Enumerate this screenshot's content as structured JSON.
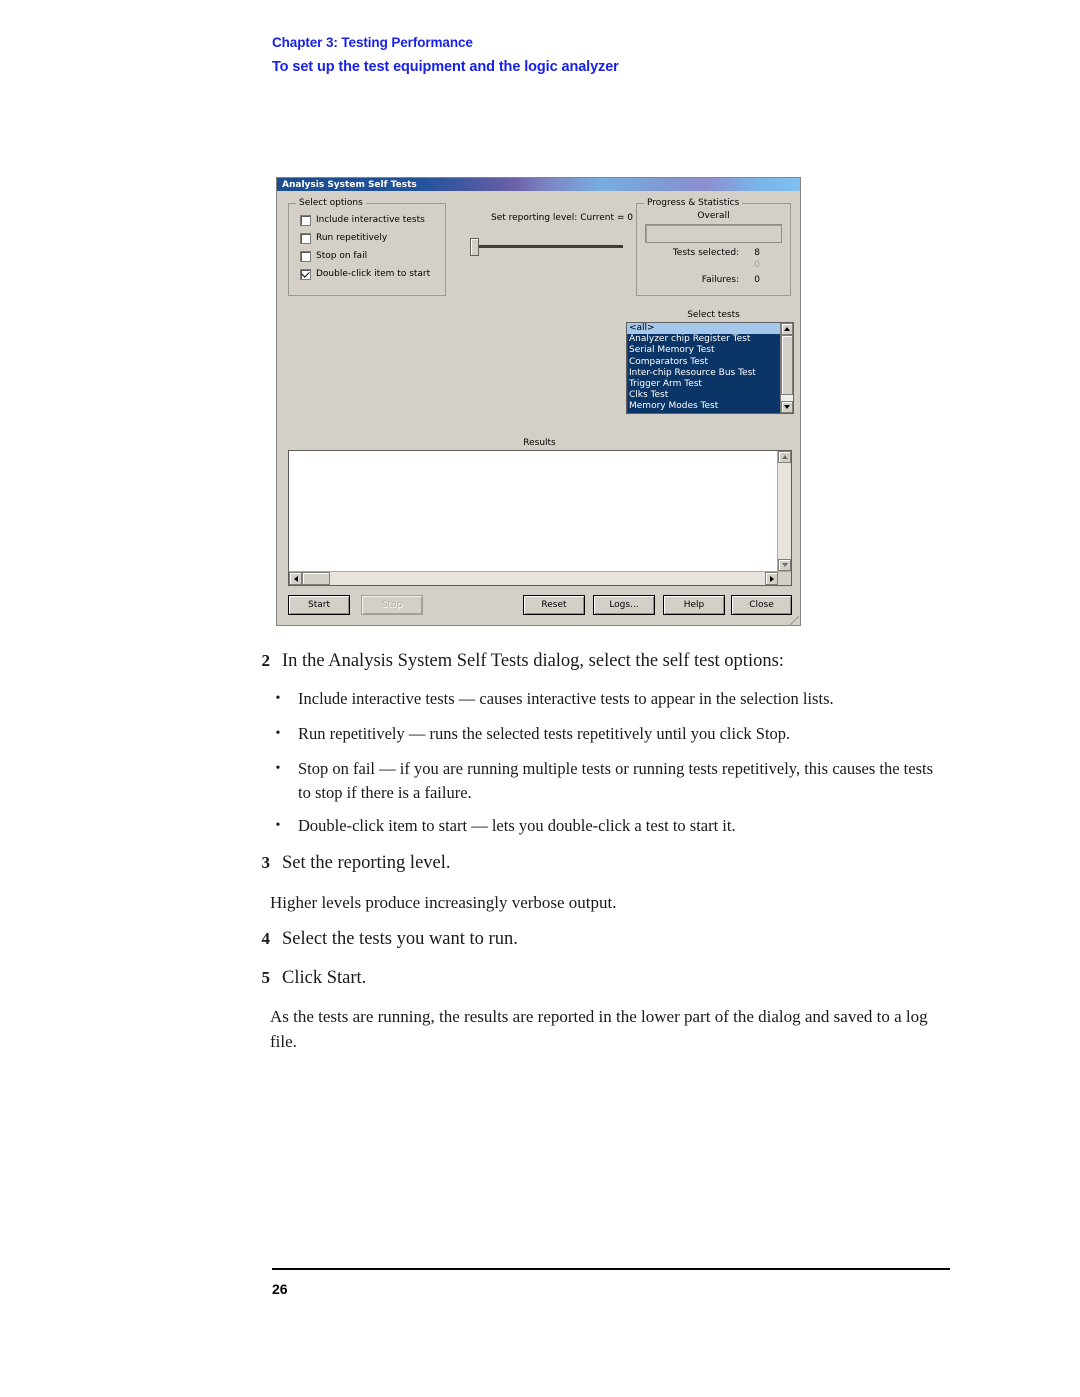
{
  "header": {
    "chapter": "Chapter 3: Testing Performance",
    "task": "To set up the test equipment and the logic analyzer",
    "accent_color": "#1822e6"
  },
  "dialog": {
    "title": "Analysis System Self Tests",
    "options_group": {
      "legend": "Select options",
      "items": [
        {
          "label": "Include interactive tests",
          "checked": false
        },
        {
          "label": "Run repetitively",
          "checked": false
        },
        {
          "label": "Stop on fail",
          "checked": false
        },
        {
          "label": "Double-click item to start",
          "checked": true
        }
      ]
    },
    "reporting": {
      "caption": "Set reporting level: Current =  0",
      "value": 0
    },
    "stats_group": {
      "legend": "Progress & Statistics",
      "overall_label": "Overall",
      "progress_percent": 0,
      "tests_selected_label": "Tests selected:",
      "tests_selected_value": "8",
      "middle_faint_value": "0",
      "failures_label": "Failures:",
      "failures_value": "0"
    },
    "select_tests": {
      "label": "Select tests",
      "items": [
        "<all>",
        "Analyzer chip Register Test",
        "Serial Memory Test",
        "Comparators Test",
        "Inter-chip Resource Bus Test",
        "Trigger Arm Test",
        "Clks Test",
        "Memory Modes Test"
      ],
      "current_index": 0,
      "selection_bg": "#0b3566",
      "current_bg": "#a4c8ec"
    },
    "results": {
      "label": "Results",
      "content": ""
    },
    "buttons": [
      {
        "id": "start",
        "label": "Start",
        "disabled": false
      },
      {
        "id": "stop",
        "label": "Stop",
        "disabled": true
      },
      {
        "id": "reset",
        "label": "Reset",
        "disabled": false
      },
      {
        "id": "logs",
        "label": "Logs...",
        "disabled": false
      },
      {
        "id": "help",
        "label": "Help",
        "disabled": false
      },
      {
        "id": "close",
        "label": "Close",
        "disabled": false
      }
    ]
  },
  "content": {
    "step2_num": "2",
    "step2_text": "In the Analysis System Self Tests dialog, select the self test options:",
    "bullets": [
      "Include interactive tests — causes interactive tests to appear in the selection lists.",
      "Run repetitively — runs the selected tests repetitively until you click Stop.",
      "Stop on fail — if you are running multiple tests or running tests repetitively, this causes the tests to stop if there is a failure.",
      "Double-click item to start — lets you double-click a test to start it."
    ],
    "bullet_marker": "•",
    "step3_num": "3",
    "step3_text": "Set the reporting level.",
    "step3_para": "Higher levels produce increasingly verbose output.",
    "step4_num": "4",
    "step4_text": "Select the tests you want to run.",
    "step5_num": "5",
    "step5_text": "Click Start.",
    "step5_para": "As the tests are running, the results are reported in the lower part of the dialog and saved to a log file."
  },
  "footer": {
    "page_number": "26"
  }
}
